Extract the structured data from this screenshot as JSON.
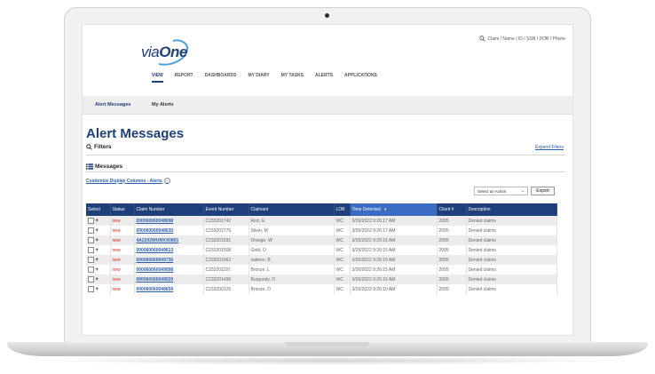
{
  "app": {
    "logo_text_a": "via",
    "logo_text_b": "One",
    "search_placeholder": "Claim / Name / ID / SSN / DOB / Phone"
  },
  "nav": {
    "items": [
      "VIEW",
      "REPORT",
      "DASHBOARDS",
      "MY DIARY",
      "MY TASKS",
      "ALERTS",
      "APPLICATIONS"
    ]
  },
  "subtabs": [
    "Alert Messages",
    "My Alerts"
  ],
  "page": {
    "title": "Alert Messages",
    "filters_label": "Filters",
    "expand_filters": "Expand Filters",
    "messages_label": "Messages",
    "customize_link": "Customize Display Columns - Alerts",
    "action_select": "Select an Action",
    "export_label": "Export"
  },
  "table": {
    "headers": [
      "Select",
      "Status",
      "Claim Number",
      "Event Number",
      "Claimant",
      "LOB",
      "Time Detected",
      "Client #",
      "Description"
    ],
    "rows": [
      {
        "status": "new",
        "claim": "000060060048698",
        "event": "C233201742",
        "claimant": "Red, G",
        "lob": "WC",
        "time": "3/26/2022 9:26:17 AM",
        "client": "2095",
        "desc": "Denied claims"
      },
      {
        "status": "new",
        "claim": "000060060048630",
        "event": "C233201776",
        "claimant": "Silver, M",
        "lob": "WC",
        "time": "3/26/2022 9:26:17 AM",
        "client": "2095",
        "desc": "Denied claims"
      },
      {
        "status": "new",
        "claim": "4A2202WUMXX0801",
        "event": "C233201591",
        "claimant": "Orange, W",
        "lob": "WC",
        "time": "3/26/2022 9:26:16 AM",
        "client": "2095",
        "desc": "Denied claims"
      },
      {
        "status": "new",
        "claim": "000060060049613",
        "event": "C233201508",
        "claimant": "Gold, O",
        "lob": "WC",
        "time": "3/26/2022 9:26:15 AM",
        "client": "2095",
        "desc": "Denied claims"
      },
      {
        "status": "new",
        "claim": "000060060049736",
        "event": "C233201662",
        "claimant": "salmon, B",
        "lob": "WC",
        "time": "3/26/2022 9:26:16 AM",
        "client": "2095",
        "desc": "Denied claims"
      },
      {
        "status": "new",
        "claim": "000060060049098",
        "event": "C233201187",
        "claimant": "Bronze, L",
        "lob": "WC",
        "time": "3/26/2022 9:26:15 AM",
        "client": "2095",
        "desc": "Denied claims"
      },
      {
        "status": "new",
        "claim": "000060060049020",
        "event": "C233201496",
        "claimant": "Burgundy, O",
        "lob": "WC",
        "time": "3/26/2022 9:26:15 AM",
        "client": "2095",
        "desc": "Denied claims"
      },
      {
        "status": "new",
        "claim": "000060060048659",
        "event": "C233200125",
        "claimant": "Bronze, O",
        "lob": "WC",
        "time": "3/26/2022 9:26:10 AM",
        "client": "2095",
        "desc": "Denied claims"
      }
    ]
  },
  "colors": {
    "brand": "#1f3f7a",
    "link": "#2a5db0",
    "status_new": "#e02020"
  }
}
